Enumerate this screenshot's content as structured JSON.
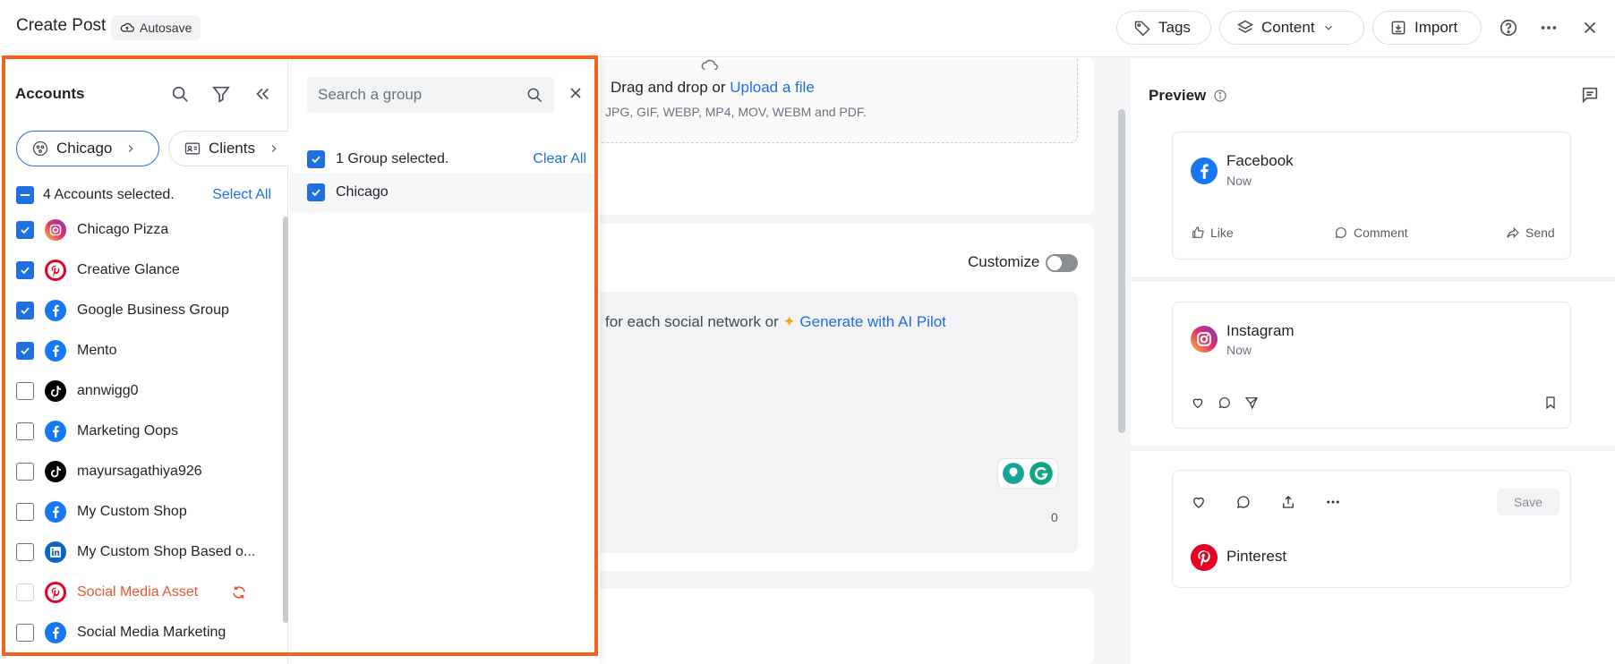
{
  "header": {
    "title": "Create Post",
    "autosave": "Autosave",
    "tags_label": "Tags",
    "content_label": "Content",
    "import_label": "Import"
  },
  "editor": {
    "dropzone_text": "Drag and drop or",
    "upload_link": "Upload a file",
    "formats": "JPG, GIF, WEBP, MP4, MOV, WEBM and PDF.",
    "customize_label": "Customize",
    "hint_text": "for each social network or",
    "ai_link": "Generate with AI Pilot",
    "char_count": "0"
  },
  "preview": {
    "title": "Preview",
    "facebook": {
      "name": "Facebook",
      "time": "Now",
      "like": "Like",
      "comment": "Comment",
      "send": "Send"
    },
    "instagram": {
      "name": "Instagram",
      "time": "Now"
    },
    "pinterest": {
      "name": "Pinterest",
      "save": "Save"
    }
  },
  "accounts": {
    "title": "Accounts",
    "chips": [
      "Chicago",
      "Clients"
    ],
    "selected_text": "4 Accounts selected.",
    "select_all": "Select All",
    "items": [
      {
        "name": "Chicago Pizza",
        "network": "instagram",
        "checked": true
      },
      {
        "name": "Creative Glance",
        "network": "pinterest",
        "checked": true
      },
      {
        "name": "Google Business Group",
        "network": "facebook",
        "checked": true
      },
      {
        "name": "Mento",
        "network": "facebook",
        "checked": true
      },
      {
        "name": "annwigg0",
        "network": "tiktok",
        "checked": false
      },
      {
        "name": "Marketing Oops",
        "network": "facebook",
        "checked": false
      },
      {
        "name": "mayursagathiya926",
        "network": "tiktok",
        "checked": false
      },
      {
        "name": "My Custom Shop",
        "network": "facebook",
        "checked": false
      },
      {
        "name": "My Custom Shop Based o...",
        "network": "linkedin",
        "checked": false
      },
      {
        "name": "Social Media Asset",
        "network": "pinterest",
        "checked": false,
        "error": true
      },
      {
        "name": "Social Media Marketing",
        "network": "facebook",
        "checked": false
      }
    ]
  },
  "groups": {
    "search_placeholder": "Search a group",
    "selected_text": "1 Group selected.",
    "clear_all": "Clear All",
    "items": [
      {
        "name": "Chicago",
        "checked": true
      }
    ]
  },
  "colors": {
    "accent": "#1e6fe0",
    "highlight": "#f4621f",
    "error": "#e4572e",
    "facebook": "#1877f2",
    "pinterest": "#e60023",
    "linkedin": "#0a66c2",
    "tiktok": "#000000"
  }
}
